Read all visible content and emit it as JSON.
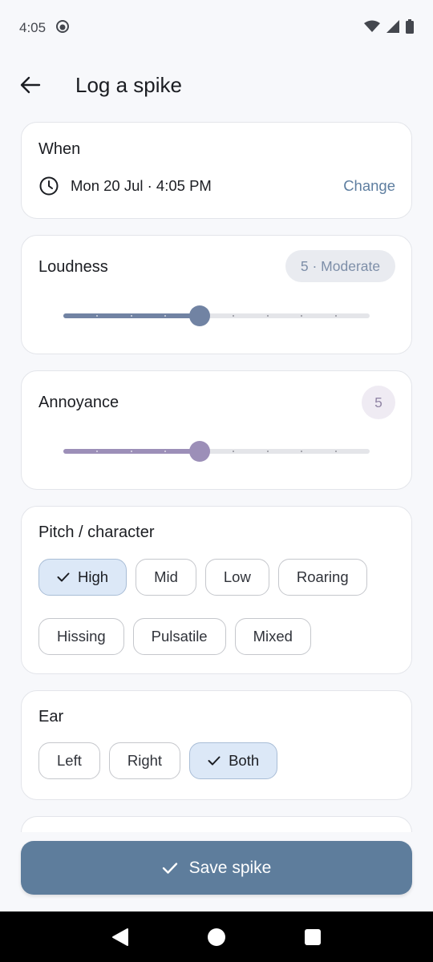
{
  "status_bar": {
    "time": "4:05"
  },
  "header": {
    "title": "Log a spike"
  },
  "when": {
    "title": "When",
    "datetime": "Mon 20 Jul · 4:05 PM",
    "change_label": "Change"
  },
  "loudness": {
    "title": "Loudness",
    "badge": "5 · Moderate",
    "value": 5,
    "min": 1,
    "max": 10,
    "color": "#7183a3"
  },
  "annoyance": {
    "title": "Annoyance",
    "badge": "5",
    "value": 5,
    "min": 1,
    "max": 10,
    "color": "#9c8fb8"
  },
  "pitch": {
    "title": "Pitch / character",
    "options": [
      {
        "label": "High",
        "selected": true
      },
      {
        "label": "Mid",
        "selected": false
      },
      {
        "label": "Low",
        "selected": false
      },
      {
        "label": "Roaring",
        "selected": false
      },
      {
        "label": "Hissing",
        "selected": false
      },
      {
        "label": "Pulsatile",
        "selected": false
      },
      {
        "label": "Mixed",
        "selected": false
      }
    ]
  },
  "ear": {
    "title": "Ear",
    "options": [
      {
        "label": "Left",
        "selected": false
      },
      {
        "label": "Right",
        "selected": false
      },
      {
        "label": "Both",
        "selected": true
      }
    ]
  },
  "save": {
    "label": "Save spike"
  },
  "colors": {
    "accent": "#5e7d9c",
    "link": "#5e7ea0",
    "chip_selected": "#dce8f7"
  }
}
